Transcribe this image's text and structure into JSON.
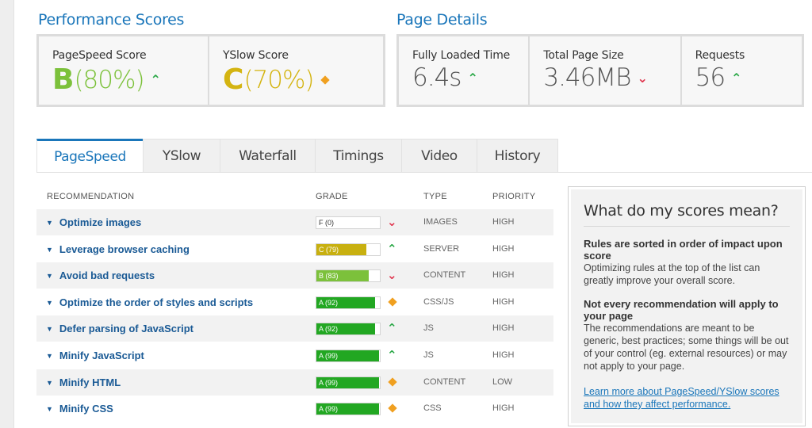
{
  "performance": {
    "title": "Performance Scores",
    "pagespeed": {
      "label": "PageSpeed Score",
      "grade": "B",
      "percent": "(80%)",
      "trend": "up",
      "color": "#7cc13b"
    },
    "yslow": {
      "label": "YSlow Score",
      "grade": "C",
      "percent": "(70%)",
      "trend": "same",
      "color": "#d4b411"
    }
  },
  "details": {
    "title": "Page Details",
    "loaded": {
      "label": "Fully Loaded Time",
      "value": "6.4s",
      "trend": "up"
    },
    "size": {
      "label": "Total Page Size",
      "value": "3.46MB",
      "trend": "down"
    },
    "requests": {
      "label": "Requests",
      "value": "56",
      "trend": "up"
    }
  },
  "tabs": [
    "PageSpeed",
    "YSlow",
    "Waterfall",
    "Timings",
    "Video",
    "History"
  ],
  "table": {
    "headers": {
      "recommendation": "RECOMMENDATION",
      "grade": "GRADE",
      "type": "TYPE",
      "priority": "PRIORITY"
    },
    "rows": [
      {
        "name": "Optimize images",
        "grade": "F (0)",
        "score": 0,
        "trend": "down",
        "type": "IMAGES",
        "priority": "HIGH"
      },
      {
        "name": "Leverage browser caching",
        "grade": "C (79)",
        "score": 79,
        "trend": "up",
        "type": "SERVER",
        "priority": "HIGH"
      },
      {
        "name": "Avoid bad requests",
        "grade": "B (83)",
        "score": 83,
        "trend": "down",
        "type": "CONTENT",
        "priority": "HIGH"
      },
      {
        "name": "Optimize the order of styles and scripts",
        "grade": "A (92)",
        "score": 92,
        "trend": "same",
        "type": "CSS/JS",
        "priority": "HIGH"
      },
      {
        "name": "Defer parsing of JavaScript",
        "grade": "A (92)",
        "score": 92,
        "trend": "up",
        "type": "JS",
        "priority": "HIGH"
      },
      {
        "name": "Minify JavaScript",
        "grade": "A (99)",
        "score": 99,
        "trend": "up",
        "type": "JS",
        "priority": "HIGH"
      },
      {
        "name": "Minify HTML",
        "grade": "A (99)",
        "score": 99,
        "trend": "same",
        "type": "CONTENT",
        "priority": "LOW"
      },
      {
        "name": "Minify CSS",
        "grade": "A (99)",
        "score": 99,
        "trend": "same",
        "type": "CSS",
        "priority": "HIGH"
      }
    ]
  },
  "info": {
    "title": "What do my scores mean?",
    "h1": "Rules are sorted in order of impact upon score",
    "p1": "Optimizing rules at the top of the list can greatly improve your overall score.",
    "h2": "Not every recommendation will apply to your page",
    "p2": "The recommendations are meant to be generic, best practices; some things will be out of your control (eg. external resources) or may not apply to your page.",
    "link": "Learn more about PageSpeed/YSlow scores and how they affect performance."
  },
  "colors": {
    "accent": "#1a76ba",
    "gradeA": "#22a722",
    "gradeB": "#7cc13b",
    "gradeC": "#c8b010",
    "up": "#28a745",
    "down": "#e0344d",
    "same": "#f0a020"
  },
  "icons": {
    "up": "chevron-up-icon",
    "down": "chevron-down-icon",
    "same": "diamond-icon",
    "expand": "triangle-down-icon"
  }
}
